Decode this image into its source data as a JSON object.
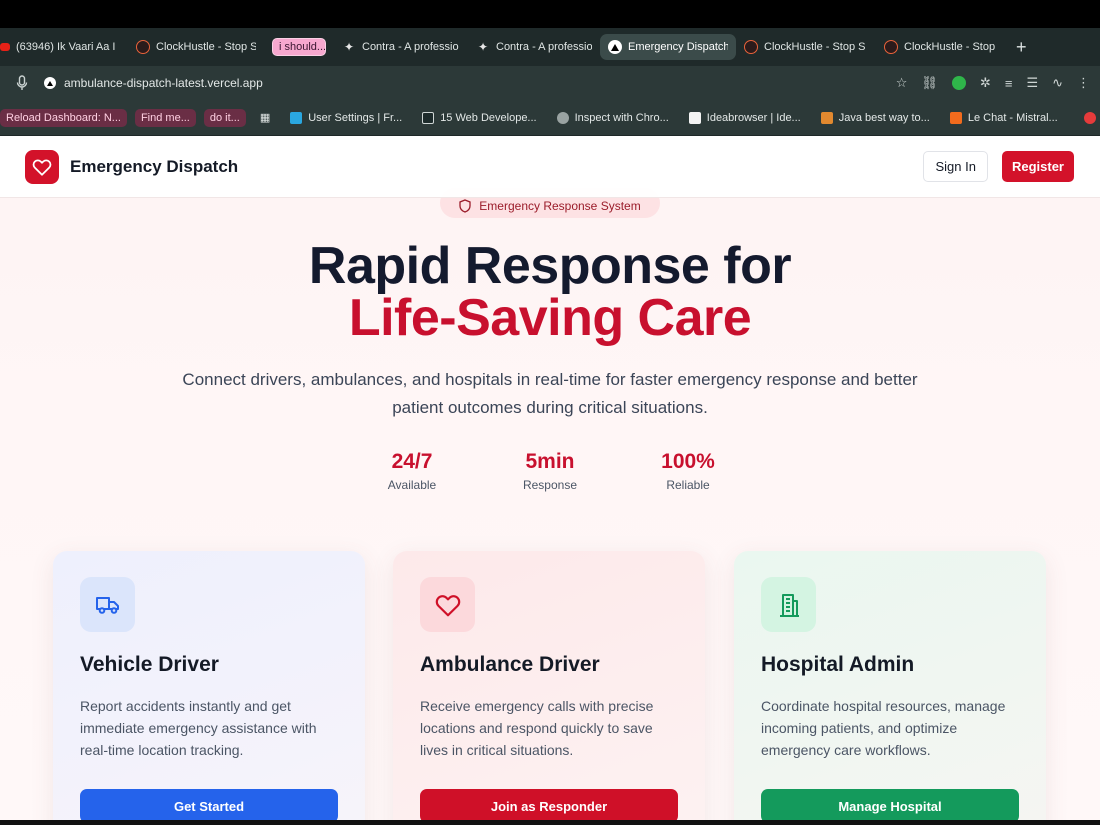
{
  "browser": {
    "tabs": [
      {
        "label": "(63946) Ik Vaari Aa I",
        "icon": "youtube-icon"
      },
      {
        "label": "ClockHustle - Stop S",
        "icon": "clockhustle-icon"
      },
      {
        "label": "i should...",
        "icon": "none"
      },
      {
        "label": "Contra - A professio",
        "icon": "contra-icon"
      },
      {
        "label": "Contra - A professio",
        "icon": "contra-icon"
      },
      {
        "label": "Emergency Dispatch",
        "icon": "vercel-icon",
        "active": true
      },
      {
        "label": "ClockHustle - Stop S",
        "icon": "clockhustle-icon"
      },
      {
        "label": "ClockHustle - Stop S",
        "icon": "clockhustle-icon"
      }
    ],
    "new_tab": "+",
    "url": "ambulance-dispatch-latest.vercel.app",
    "bookmarks": [
      {
        "label": "Reload Dashboard: N...",
        "style": "pink"
      },
      {
        "label": "Find me...",
        "style": "pink"
      },
      {
        "label": "do it...",
        "style": "pink"
      },
      {
        "label": "User Settings | Fr...",
        "style": "normal"
      },
      {
        "label": "15 Web Develope...",
        "style": "normal"
      },
      {
        "label": "Inspect with Chro...",
        "style": "normal"
      },
      {
        "label": "Ideabrowser | Ide...",
        "style": "normal"
      },
      {
        "label": "Java best way to...",
        "style": "normal"
      },
      {
        "label": "Le Chat - Mistral...",
        "style": "normal"
      }
    ]
  },
  "navbar": {
    "brand": "Emergency Dispatch",
    "sign_in": "Sign In",
    "register": "Register"
  },
  "hero": {
    "badge": "Emergency Response System",
    "title_line1": "Rapid Response for",
    "title_line2": "Life-Saving Care",
    "subtitle": "Connect drivers, ambulances, and hospitals in real-time for faster emergency response and better patient outcomes during critical situations."
  },
  "stats": [
    {
      "value": "24/7",
      "label": "Available"
    },
    {
      "value": "5min",
      "label": "Response"
    },
    {
      "value": "100%",
      "label": "Reliable"
    }
  ],
  "cards": [
    {
      "title": "Vehicle Driver",
      "description": "Report accidents instantly and get immediate emergency assistance with real-time location tracking.",
      "button": "Get Started",
      "icon": "truck-icon"
    },
    {
      "title": "Ambulance Driver",
      "description": "Receive emergency calls with precise locations and respond quickly to save lives in critical situations.",
      "button": "Join as Responder",
      "icon": "heart-icon"
    },
    {
      "title": "Hospital Admin",
      "description": "Coordinate hospital resources, manage incoming patients, and optimize emergency care workflows.",
      "button": "Manage Hospital",
      "icon": "building-icon"
    }
  ],
  "colors": {
    "accent": "#d3122a",
    "blue": "#2563eb",
    "green": "#149a5c"
  }
}
